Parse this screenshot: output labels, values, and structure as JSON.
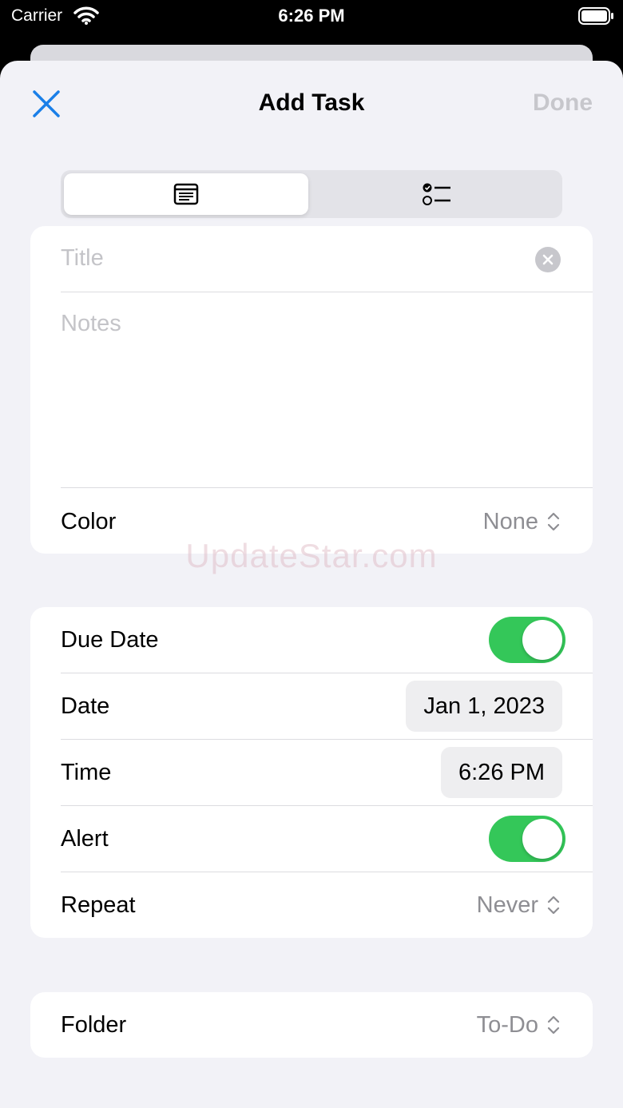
{
  "status_bar": {
    "carrier": "Carrier",
    "time": "6:26 PM"
  },
  "header": {
    "title": "Add Task",
    "done_label": "Done"
  },
  "segments": [
    {
      "icon": "note-icon",
      "selected": true
    },
    {
      "icon": "checklist-icon",
      "selected": false
    }
  ],
  "details": {
    "title_placeholder": "Title",
    "notes_placeholder": "Notes",
    "color_label": "Color",
    "color_value": "None"
  },
  "schedule": {
    "due_date_label": "Due Date",
    "due_date_on": true,
    "date_label": "Date",
    "date_value": "Jan 1, 2023",
    "time_label": "Time",
    "time_value": "6:26 PM",
    "alert_label": "Alert",
    "alert_on": true,
    "repeat_label": "Repeat",
    "repeat_value": "Never"
  },
  "folder": {
    "label": "Folder",
    "value": "To-Do"
  },
  "watermark": "UpdateStar.com",
  "colors": {
    "accent": "#1a7fe8",
    "toggle_on": "#34c759",
    "background": "#f2f2f7"
  }
}
